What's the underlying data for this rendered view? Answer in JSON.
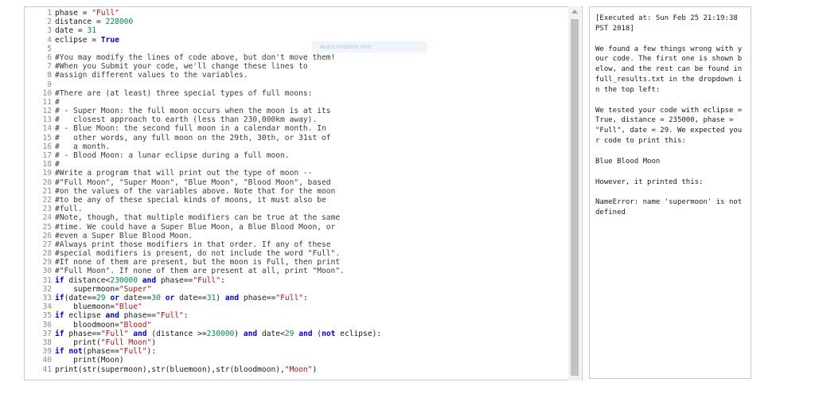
{
  "editor": {
    "hint_text": "Autocomplete hint",
    "lines": [
      [
        {
          "t": "phase = ",
          "c": ""
        },
        {
          "t": "\"Full\"",
          "c": "str"
        }
      ],
      [
        {
          "t": "distance = ",
          "c": ""
        },
        {
          "t": "228000",
          "c": "num"
        }
      ],
      [
        {
          "t": "date = ",
          "c": ""
        },
        {
          "t": "31",
          "c": "num"
        }
      ],
      [
        {
          "t": "eclipse = ",
          "c": ""
        },
        {
          "t": "True",
          "c": "kw"
        }
      ],
      [],
      [
        {
          "t": "#You may modify the lines of code above, but don't move them!",
          "c": "com"
        }
      ],
      [
        {
          "t": "#When you Submit your code, we'll change these lines to",
          "c": "com"
        }
      ],
      [
        {
          "t": "#assign different values to the variables.",
          "c": "com"
        }
      ],
      [],
      [
        {
          "t": "#There are (at least) three special types of full moons:",
          "c": "com"
        }
      ],
      [
        {
          "t": "#",
          "c": "com"
        }
      ],
      [
        {
          "t": "# - Super Moon: the full moon occurs when the moon is at its",
          "c": "com"
        }
      ],
      [
        {
          "t": "#   closest approach to earth (less than 230,000km away).",
          "c": "com"
        }
      ],
      [
        {
          "t": "# - Blue Moon: the second full moon in a calendar month. In",
          "c": "com"
        }
      ],
      [
        {
          "t": "#   other words, any full moon on the 29th, 30th, or 31st of",
          "c": "com"
        }
      ],
      [
        {
          "t": "#   a month.",
          "c": "com"
        }
      ],
      [
        {
          "t": "# - Blood Moon: a lunar eclipse during a full moon.",
          "c": "com"
        }
      ],
      [
        {
          "t": "#",
          "c": "com"
        }
      ],
      [
        {
          "t": "#Write a program that will print out the type of moon --",
          "c": "com"
        }
      ],
      [
        {
          "t": "#\"Full Moon\", \"Super Moon\", \"Blue Moon\", \"Blood Moon\", based",
          "c": "com"
        }
      ],
      [
        {
          "t": "#on the values of the variables above. Note that for the moon",
          "c": "com"
        }
      ],
      [
        {
          "t": "#to be any of these special kinds of moons, it must also be",
          "c": "com"
        }
      ],
      [
        {
          "t": "#full.",
          "c": "com"
        }
      ],
      [
        {
          "t": "#Note, though, that multiple modifiers can be true at the same",
          "c": "com"
        }
      ],
      [
        {
          "t": "#time. We could have a Super Blue Moon, a Blue Blood Moon, or",
          "c": "com"
        }
      ],
      [
        {
          "t": "#even a Super Blue Blood Moon.",
          "c": "com"
        }
      ],
      [
        {
          "t": "#Always print those modifiers in that order. If any of these",
          "c": "com"
        }
      ],
      [
        {
          "t": "#special modifiers is present, do not include the word \"Full\".",
          "c": "com"
        }
      ],
      [
        {
          "t": "#If none of them are present, but the moon is Full, then print",
          "c": "com"
        }
      ],
      [
        {
          "t": "#\"Full Moon\". If none of them are present at all, print \"Moon\".",
          "c": "com"
        }
      ],
      [
        {
          "t": "if",
          "c": "kw"
        },
        {
          "t": " distance<",
          "c": ""
        },
        {
          "t": "230000",
          "c": "num"
        },
        {
          "t": " ",
          "c": ""
        },
        {
          "t": "and",
          "c": "kw"
        },
        {
          "t": " phase==",
          "c": ""
        },
        {
          "t": "\"Full\"",
          "c": "str"
        },
        {
          "t": ":",
          "c": ""
        }
      ],
      [
        {
          "t": "    supermoon=",
          "c": ""
        },
        {
          "t": "\"Super\"",
          "c": "str"
        }
      ],
      [
        {
          "t": "if",
          "c": "kw"
        },
        {
          "t": "(date==",
          "c": ""
        },
        {
          "t": "29",
          "c": "num"
        },
        {
          "t": " ",
          "c": ""
        },
        {
          "t": "or",
          "c": "kw"
        },
        {
          "t": " date==",
          "c": ""
        },
        {
          "t": "30",
          "c": "num"
        },
        {
          "t": " ",
          "c": ""
        },
        {
          "t": "or",
          "c": "kw"
        },
        {
          "t": " date==",
          "c": ""
        },
        {
          "t": "31",
          "c": "num"
        },
        {
          "t": ") ",
          "c": ""
        },
        {
          "t": "and",
          "c": "kw"
        },
        {
          "t": " phase==",
          "c": ""
        },
        {
          "t": "\"Full\"",
          "c": "str"
        },
        {
          "t": ":",
          "c": ""
        }
      ],
      [
        {
          "t": "    bluemoon=",
          "c": ""
        },
        {
          "t": "\"Blue\"",
          "c": "str"
        }
      ],
      [
        {
          "t": "if",
          "c": "kw"
        },
        {
          "t": " eclipse ",
          "c": ""
        },
        {
          "t": "and",
          "c": "kw"
        },
        {
          "t": " phase==",
          "c": ""
        },
        {
          "t": "\"Full\"",
          "c": "str"
        },
        {
          "t": ":",
          "c": ""
        }
      ],
      [
        {
          "t": "    bloodmoon=",
          "c": ""
        },
        {
          "t": "\"Blood\"",
          "c": "str"
        }
      ],
      [
        {
          "t": "if",
          "c": "kw"
        },
        {
          "t": " phase==",
          "c": ""
        },
        {
          "t": "\"Full\"",
          "c": "str"
        },
        {
          "t": " ",
          "c": ""
        },
        {
          "t": "and",
          "c": "kw"
        },
        {
          "t": " (distance >=",
          "c": ""
        },
        {
          "t": "230000",
          "c": "num"
        },
        {
          "t": ") ",
          "c": ""
        },
        {
          "t": "and",
          "c": "kw"
        },
        {
          "t": " date<",
          "c": ""
        },
        {
          "t": "29",
          "c": "num"
        },
        {
          "t": " ",
          "c": ""
        },
        {
          "t": "and",
          "c": "kw"
        },
        {
          "t": " (",
          "c": ""
        },
        {
          "t": "not",
          "c": "kw"
        },
        {
          "t": " eclipse):",
          "c": ""
        }
      ],
      [
        {
          "t": "    print(",
          "c": ""
        },
        {
          "t": "\"Full Moon\"",
          "c": "str"
        },
        {
          "t": ")",
          "c": ""
        }
      ],
      [
        {
          "t": "if",
          "c": "kw"
        },
        {
          "t": " ",
          "c": ""
        },
        {
          "t": "not",
          "c": "kw"
        },
        {
          "t": "(phase==",
          "c": ""
        },
        {
          "t": "\"Full\"",
          "c": "str"
        },
        {
          "t": "):",
          "c": ""
        }
      ],
      [
        {
          "t": "    print(Moon)",
          "c": ""
        }
      ],
      [
        {
          "t": "print(str(supermoon),str(bluemoon),str(bloodmoon),",
          "c": ""
        },
        {
          "t": "\"Moon\"",
          "c": "str"
        },
        {
          "t": ")",
          "c": ""
        }
      ]
    ]
  },
  "output": {
    "executed_at": "[Executed at: Sun Feb 25 21:19:38 PST 2018]",
    "wrong_msg": "We found a few things wrong with your code. The first one is shown below, and the rest can be found in full_results.txt in the dropdown in the top left:",
    "tested_msg": "We tested your code with eclipse = True, distance = 235000, phase = \"Full\", date = 29. We expected your code to print this:",
    "expected": "Blue Blood Moon",
    "however": "However, it printed this:",
    "error": "NameError: name 'supermoon' is not defined"
  }
}
